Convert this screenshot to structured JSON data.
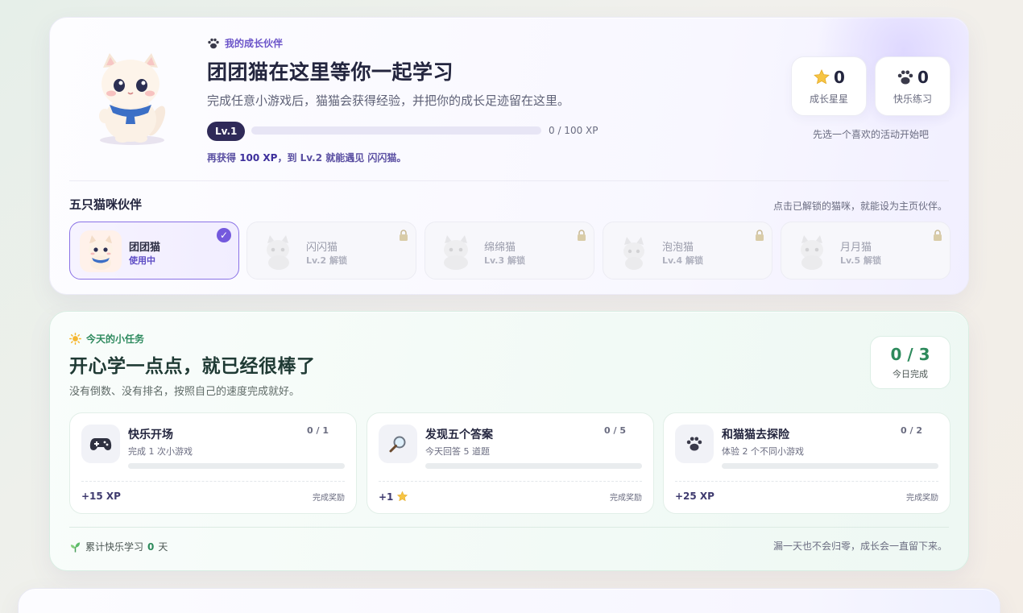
{
  "companion": {
    "kicker": "我的成长伙伴",
    "title": "团团猫在这里等你一起学习",
    "subtitle": "完成任意小游戏后，猫猫会获得经验，并把你的成长足迹留在这里。",
    "level_badge": "Lv.1",
    "xp_progress": 0,
    "xp_text": "0 / 100 XP",
    "hint_prefix": "再获得 ",
    "hint_xp": "100 XP",
    "hint_suffix": "，到 Lv.2 就能遇见 闪闪猫。",
    "stats": [
      {
        "icon": "star-icon",
        "value": "0",
        "label": "成长星星"
      },
      {
        "icon": "paw-icon",
        "value": "0",
        "label": "快乐练习"
      }
    ],
    "stats_hint": "先选一个喜欢的活动开始吧",
    "cats_title": "五只猫咪伙伴",
    "cats_hint": "点击已解锁的猫咪，就能设为主页伙伴。",
    "cats": [
      {
        "name": "团团猫",
        "status": "使用中",
        "active": true,
        "locked": false
      },
      {
        "name": "闪闪猫",
        "status": "Lv.2 解锁",
        "active": false,
        "locked": true
      },
      {
        "name": "绵绵猫",
        "status": "Lv.3 解锁",
        "active": false,
        "locked": true
      },
      {
        "name": "泡泡猫",
        "status": "Lv.4 解锁",
        "active": false,
        "locked": true
      },
      {
        "name": "月月猫",
        "status": "Lv.5 解锁",
        "active": false,
        "locked": true
      }
    ]
  },
  "tasks": {
    "kicker": "今天的小任务",
    "title": "开心学一点点，就已经很棒了",
    "subtitle": "没有倒数、没有排名，按照自己的速度完成就好。",
    "today_value": "0 / 3",
    "today_label": "今日完成",
    "items": [
      {
        "icon": "gamepad-icon",
        "glyph": "🎮",
        "name": "快乐开场",
        "desc": "完成 1 次小游戏",
        "count": "0 / 1",
        "progress": 0,
        "reward": "+15 XP",
        "reward_label": "完成奖励"
      },
      {
        "icon": "magnifier-icon",
        "glyph": "🔎",
        "name": "发现五个答案",
        "desc": "今天回答 5 道题",
        "count": "0 / 5",
        "progress": 0,
        "reward": "+1",
        "reward_icon": "star-icon",
        "reward_label": "完成奖励"
      },
      {
        "icon": "paw-icon",
        "glyph": "🐾",
        "name": "和猫猫去探险",
        "desc": "体验 2 个不同小游戏",
        "count": "0 / 2",
        "progress": 0,
        "reward": "+25 XP",
        "reward_label": "完成奖励"
      }
    ],
    "streak_prefix": "累计快乐学习",
    "streak_value": "0",
    "streak_suffix": "天",
    "footer_note": "漏一天也不会归零，成长会一直留下来。"
  },
  "colors": {
    "accent_purple": "#7459dd",
    "accent_green": "#2d8a5c"
  }
}
